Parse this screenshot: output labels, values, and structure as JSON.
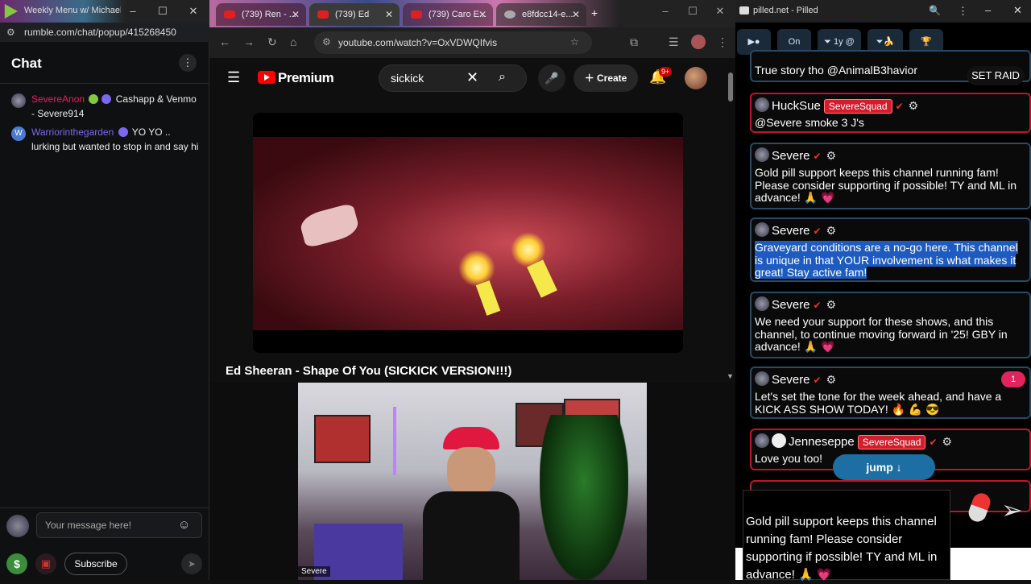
{
  "rumble": {
    "tab_title": "Weekly Menu w/ Michael Ri...",
    "url": "rumble.com/chat/popup/415268450",
    "chat_title": "Chat",
    "messages": [
      {
        "user": "SevereAnon",
        "user_color": "#e0245e",
        "text": "Cashapp & Venmo - Severe914"
      },
      {
        "user": "Warriorinthegarden",
        "user_color": "#7b68ee",
        "text": "YO YO .. lurking but wanted to stop in and say hi"
      }
    ],
    "input_placeholder": "Your message here!",
    "subscribe_label": "Subscribe",
    "icons": {
      "currency": "$",
      "gift": "gift-icon",
      "send": "send-icon"
    }
  },
  "youtube": {
    "tabs": [
      {
        "label": "(739) Ren - ..."
      },
      {
        "label": "(739) Ed"
      },
      {
        "label": "(739) Caro E..."
      },
      {
        "label": "e8fdcc14-e..."
      }
    ],
    "url": "youtube.com/watch?v=OxVDWQIfvis",
    "brand": "Premium",
    "search_query": "sickick",
    "create_label": "Create",
    "notification_count": "9+",
    "video_title": "Ed Sheeran - Shape Of You (SICKICK VERSION!!!)"
  },
  "webcam": {
    "label": "Severe"
  },
  "pilled": {
    "window_title": "pilled.net - Pilled",
    "toolbar": {
      "on_label": "On",
      "filter_label": "1y @"
    },
    "set_raid_label": "SET RAID",
    "unread_count": "1",
    "jump_label": "jump ↓",
    "squad_badge": "SevereSquad",
    "messages": [
      {
        "user": "Severe",
        "style": "blue",
        "text": "True story tho @AnimalB3havior"
      },
      {
        "user": "HuckSue",
        "style": "red",
        "squad": true,
        "text": "@Severe smoke 3 J's"
      },
      {
        "user": "Severe",
        "style": "blue",
        "text": "Gold pill support keeps this channel running fam! Please consider supporting if possible! TY and ML in advance! 🙏 💗"
      },
      {
        "user": "Severe",
        "style": "blue",
        "highlight": true,
        "text": "Graveyard conditions are a no-go here. This channel is unique in that YOUR involvement is what makes it great! Stay active fam!"
      },
      {
        "user": "Severe",
        "style": "blue",
        "text": "We need your support for these shows, and this channel, to continue moving forward in '25! GBY in advance! 🙏 💗"
      },
      {
        "user": "Severe",
        "style": "blue",
        "text": "Let's set the tone for the week ahead, and have a KICK ASS SHOW TODAY! 🔥 💪 😎"
      },
      {
        "user": "Jenneseppe",
        "style": "red",
        "squad": true,
        "text": "Love you too!"
      }
    ],
    "compose_text": "Gold pill support keeps this channel running fam! Please consider supporting if possible! TY and ML in advance! 🙏 💗"
  }
}
